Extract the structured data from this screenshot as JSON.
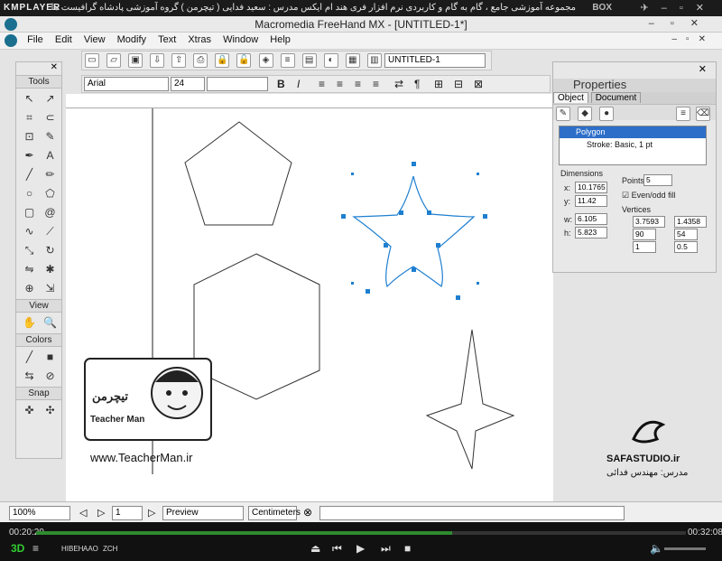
{
  "player": {
    "logo": "KMPLAYER",
    "caption": "مجموعه آموزشی جامع ، گام به گام و کاربردی نرم افزار فری هند ام ایکس  مدرس : سعید فدایی ( تیچرمن ) گروه آموزشی پادشاه گرافیست ها",
    "box": "BOX",
    "time_elapsed": "00:20:29",
    "time_total": "00:32:08",
    "progress": 0.64,
    "badge": "3D",
    "mode_labels": [
      "HIBEH",
      "AAO",
      "ZCH"
    ]
  },
  "app": {
    "title": "Macromedia FreeHand MX - [UNTITLED-1*]",
    "menu": [
      "File",
      "Edit",
      "View",
      "Modify",
      "Text",
      "Xtras",
      "Window",
      "Help"
    ],
    "doc_select": "UNTITLED-1"
  },
  "text_toolbar": {
    "font": "Arial",
    "size": "24",
    "bold": "B",
    "italic": "I"
  },
  "tools": {
    "title": "Tools",
    "view_label": "View",
    "colors_label": "Colors",
    "snap_label": "Snap"
  },
  "properties": {
    "title": "Properties",
    "tabs": [
      "Object",
      "Document"
    ],
    "object_name": "Polygon",
    "stroke": "Stroke: Basic, 1 pt",
    "dimensions_label": "Dimensions",
    "x_label": "x:",
    "x": "10.1765",
    "y_label": "y:",
    "y": "11.42",
    "w_label": "w:",
    "w": "6.105",
    "h_label": "h:",
    "h": "5.823",
    "points_label": "Points:",
    "points": "5",
    "evenodd": "Even/odd fill",
    "vertices_label": "Vertices",
    "v1": "3.7593",
    "v2": "1.4358",
    "v3": "90",
    "v4": "54",
    "v5": "1",
    "v6": "0.5"
  },
  "status": {
    "zoom": "100%",
    "page": "1",
    "view_mode": "Preview",
    "units": "Centimeters"
  },
  "watermark": {
    "name_fa": "تیچرمن",
    "name_en": "Teacher Man",
    "url": "www.TeacherMan.ir"
  },
  "studio": {
    "name": "SAFASTUDIO.ir",
    "teacher": "مدرس: مهندس فدائی"
  },
  "colors": {
    "selection": "#1e7fd0",
    "player_bg": "#111111",
    "progress": "#2e8b2e"
  }
}
